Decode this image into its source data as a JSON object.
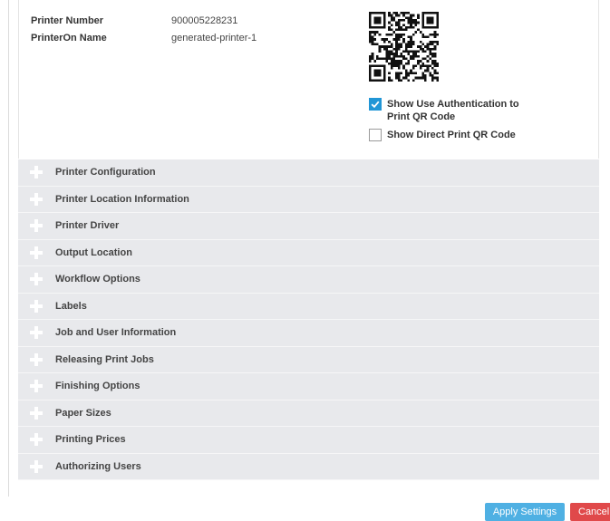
{
  "printer_info": {
    "rows": [
      {
        "label": "Printer Number",
        "value": "900005228231"
      },
      {
        "label": "PrinterOn Name",
        "value": "generated-printer-1"
      }
    ]
  },
  "qr_options": {
    "auth_qr": {
      "label": "Show Use Authentication to Print QR Code",
      "checked": true
    },
    "direct_qr": {
      "label": "Show Direct Print QR Code",
      "checked": false
    }
  },
  "sections": [
    "Printer Configuration",
    "Printer Location Information",
    "Printer Driver",
    "Output Location",
    "Workflow Options",
    "Labels",
    "Job and User Information",
    "Releasing Print Jobs",
    "Finishing Options",
    "Paper Sizes",
    "Printing Prices",
    "Authorizing Users"
  ],
  "footer": {
    "apply_label": "Apply Settings",
    "cancel_label": "Cancel"
  },
  "colors": {
    "accent": "#2196d6",
    "apply_button": "#4fb0e3",
    "cancel_button": "#e0494a",
    "section_background": "#e8e9ec"
  }
}
